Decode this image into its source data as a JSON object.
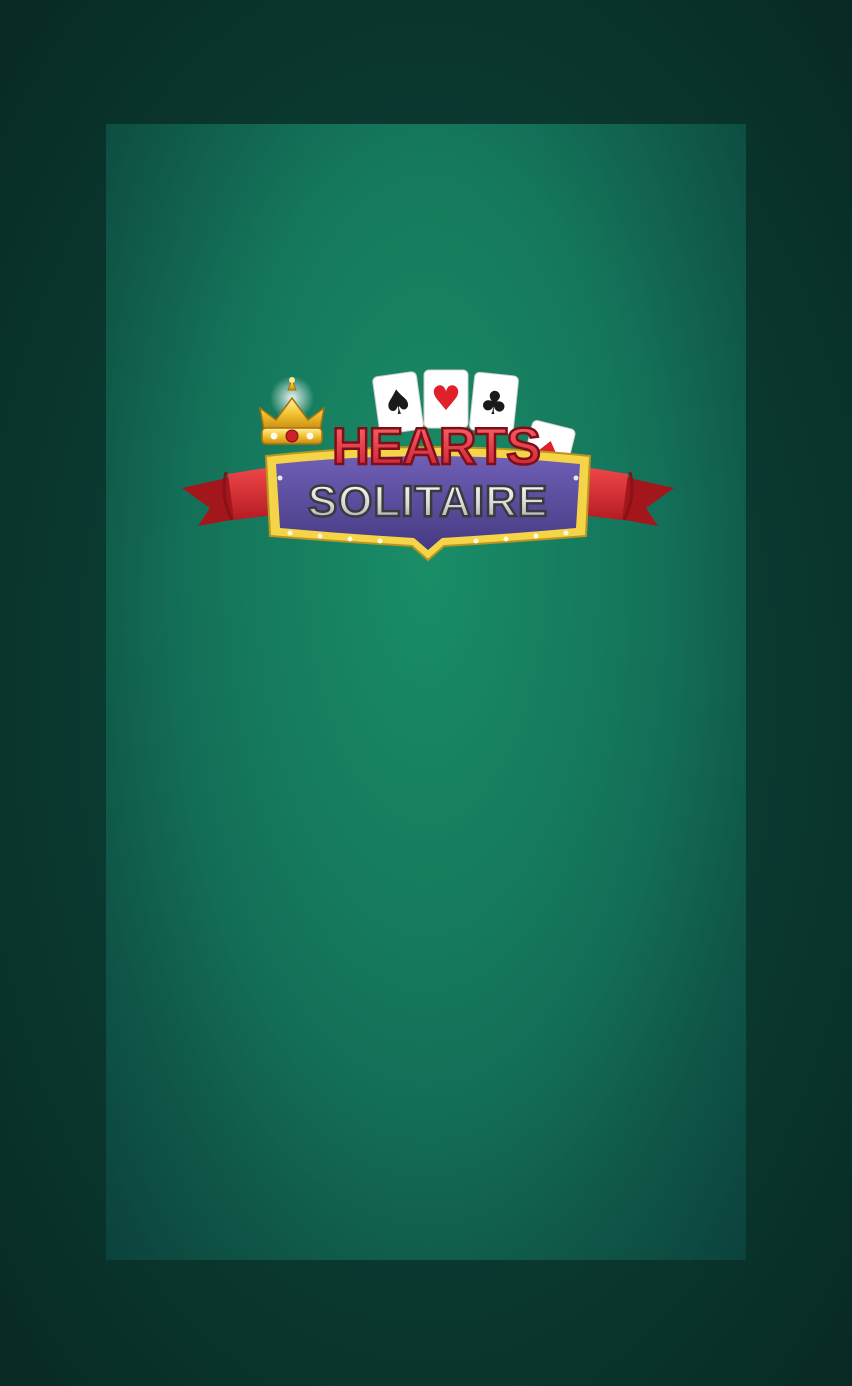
{
  "screen": {
    "name": "splash-screen"
  },
  "logo": {
    "line1": "HEARTS",
    "line2": "SOLITAIRE",
    "icons": [
      "crown-icon",
      "spade-card-icon",
      "heart-card-icon",
      "club-card-icon",
      "diamond-card-icon",
      "ribbon-banner"
    ]
  },
  "colors": {
    "felt_center": "#1a8d67",
    "felt_edge": "#0e5049",
    "outer_background": "#0b3a31",
    "ribbon_red": "#d9262c",
    "plaque_purple": "#5a4a9a",
    "plaque_border_yellow": "#f5d547",
    "hearts_red": "#e8353d",
    "solitaire_silver": "#e6e6e6"
  }
}
